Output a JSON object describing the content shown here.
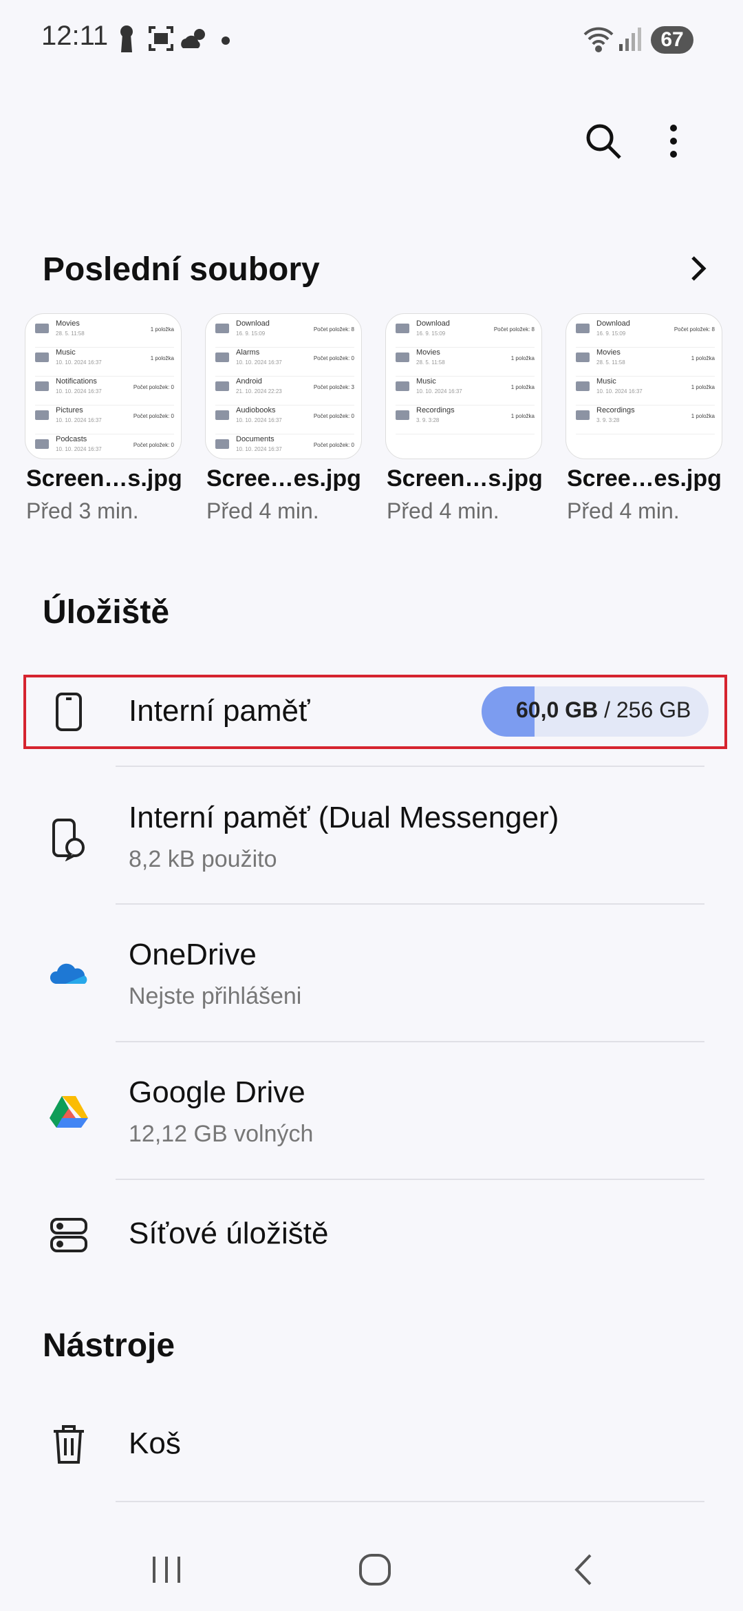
{
  "status_bar": {
    "time": "12:11",
    "battery": "67",
    "icons": [
      "keyhole-icon",
      "screenshot-icon",
      "weather-icon",
      "dot-icon",
      "wifi-icon",
      "signal-icon"
    ]
  },
  "toolbar": {
    "icons": [
      "search-icon",
      "more-options-icon"
    ]
  },
  "recent": {
    "title": "Poslední soubory",
    "files": [
      {
        "name": "Screen…s.jpg",
        "time": "Před 3 min.",
        "rows": [
          {
            "n": "Movies",
            "d": "28. 5. 11:58",
            "c": "1 položka"
          },
          {
            "n": "Music",
            "d": "10. 10. 2024 16:37",
            "c": "1 položka"
          },
          {
            "n": "Notifications",
            "d": "10. 10. 2024 16:37",
            "c": "Počet položek: 0"
          },
          {
            "n": "Pictures",
            "d": "10. 10. 2024 16:37",
            "c": "Počet položek: 0"
          },
          {
            "n": "Podcasts",
            "d": "10. 10. 2024 16:37",
            "c": "Počet položek: 0"
          }
        ]
      },
      {
        "name": "Scree…es.jpg",
        "time": "Před 4 min.",
        "rows": [
          {
            "n": "Download",
            "d": "16. 9. 15:09",
            "c": "Počet položek: 8"
          },
          {
            "n": "Alarms",
            "d": "10. 10. 2024 16:37",
            "c": "Počet položek: 0"
          },
          {
            "n": "Android",
            "d": "21. 10. 2024 22:23",
            "c": "Počet položek: 3"
          },
          {
            "n": "Audiobooks",
            "d": "10. 10. 2024 16:37",
            "c": "Počet položek: 0"
          },
          {
            "n": "Documents",
            "d": "10. 10. 2024 16:37",
            "c": "Počet položek: 0"
          }
        ]
      },
      {
        "name": "Screen…s.jpg",
        "time": "Před 4 min.",
        "rows": [
          {
            "n": "Download",
            "d": "16. 9. 15:09",
            "c": "Počet položek: 8"
          },
          {
            "n": "Movies",
            "d": "28. 5. 11:58",
            "c": "1 položka"
          },
          {
            "n": "Music",
            "d": "10. 10. 2024 16:37",
            "c": "1 položka"
          },
          {
            "n": "Recordings",
            "d": "3. 9. 3:28",
            "c": "1 položka"
          }
        ]
      },
      {
        "name": "Scree…es.jpg",
        "time": "Před 4 min.",
        "rows": [
          {
            "n": "Download",
            "d": "16. 9. 15:09",
            "c": "Počet položek: 8"
          },
          {
            "n": "Movies",
            "d": "28. 5. 11:58",
            "c": "1 položka"
          },
          {
            "n": "Music",
            "d": "10. 10. 2024 16:37",
            "c": "1 položka"
          },
          {
            "n": "Recordings",
            "d": "3. 9. 3:28",
            "c": "1 položka"
          }
        ]
      }
    ]
  },
  "storage": {
    "title": "Úložiště",
    "internal": {
      "label": "Interní paměť",
      "used": "60,0 GB",
      "separator": " / ",
      "total": "256 GB",
      "used_fraction": 0.234
    },
    "dual": {
      "label": "Interní paměť (Dual Messenger)",
      "sub": "8,2 kB použito"
    },
    "onedrive": {
      "label": "OneDrive",
      "sub": "Nejste přihlášeni"
    },
    "gdrive": {
      "label": "Google Drive",
      "sub": "12,12 GB volných"
    },
    "network": {
      "label": "Síťové úložiště"
    }
  },
  "tools": {
    "title": "Nástroje",
    "trash": {
      "label": "Koš"
    }
  },
  "colors": {
    "accent": "#7c9cf0",
    "highlight": "#d6242f",
    "onedrive": "#1e78d4"
  }
}
